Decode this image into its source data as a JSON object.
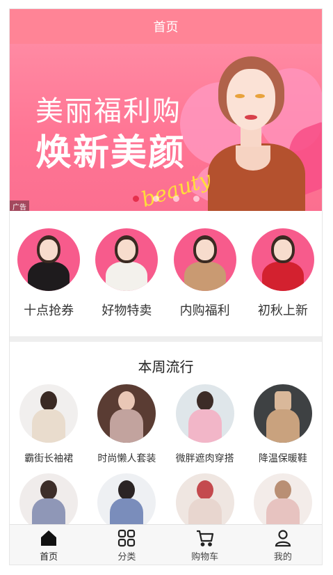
{
  "header": {
    "title": "首页"
  },
  "banner": {
    "line1": "美丽福利购",
    "line2": "焕新美颜",
    "script": "beauty",
    "ad_label": "广告",
    "slide_count": 4,
    "active_slide": 1
  },
  "categories": [
    {
      "label": "十点抢券"
    },
    {
      "label": "好物特卖"
    },
    {
      "label": "内购福利"
    },
    {
      "label": "初秋上新"
    }
  ],
  "weekly": {
    "title": "本周流行",
    "items": [
      {
        "label": "霸街长袖裙"
      },
      {
        "label": "时尚懒人套装"
      },
      {
        "label": "微胖遮肉穿搭"
      },
      {
        "label": "降温保暖鞋"
      },
      {
        "label": ""
      },
      {
        "label": ""
      },
      {
        "label": ""
      },
      {
        "label": ""
      }
    ]
  },
  "tabbar": {
    "tabs": [
      {
        "label": "首页",
        "icon": "home-icon"
      },
      {
        "label": "分类",
        "icon": "grid-icon"
      },
      {
        "label": "购物车",
        "icon": "cart-icon"
      },
      {
        "label": "我的",
        "icon": "user-icon"
      }
    ],
    "active_tab": 0
  },
  "colors": {
    "header": "#ff8496",
    "accent": "#f75b8c",
    "active_dot": "#e5304d"
  }
}
